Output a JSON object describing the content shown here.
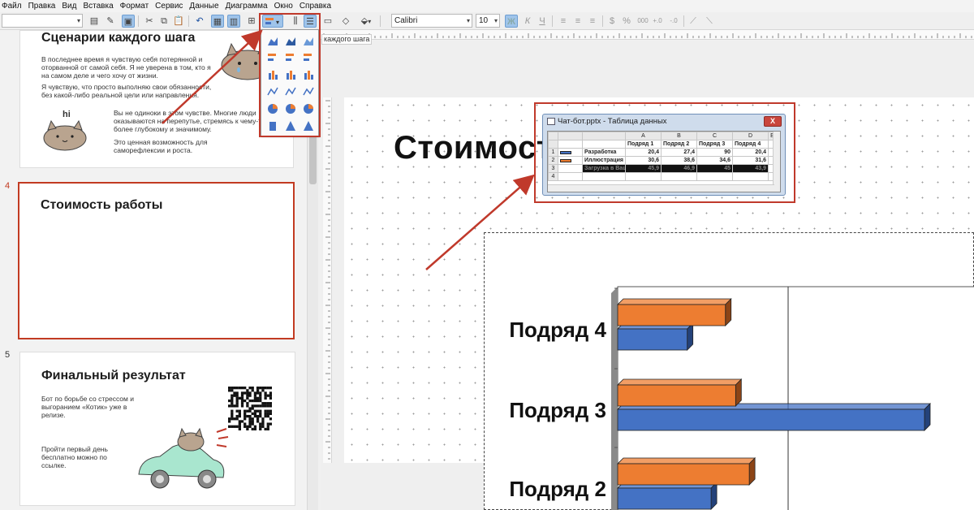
{
  "menubar": [
    "Файл",
    "Правка",
    "Вид",
    "Вставка",
    "Формат",
    "Сервис",
    "Данные",
    "Диаграмма",
    "Окно",
    "Справка"
  ],
  "toolbar": {
    "font_name": "Calibri",
    "font_size": "10",
    "bold_label": "Ж",
    "italic_label": "К",
    "underline_label": "Ч"
  },
  "tooltip": "каждого шага",
  "slides": {
    "s3": {
      "title": "Сценарии каждого шага",
      "p1": "В последнее время я чувствую себя потерянной и оторванной от самой себя. Я не уверена в том, кто я на самом деле и чего хочу от жизни.",
      "p2": "Я чувствую, что просто выполняю свои обязанности, без какой-либо реальной цели или направления.",
      "hi": "hi",
      "p3": "Вы не одиноки в этом чувстве. Многие люди оказываются на перепутье, стремясь к чему-то более глубокому и значимому.",
      "p4": "Это ценная возможность для саморефлексии и роста."
    },
    "s4": {
      "num": "4",
      "title": "Стоимость работы"
    },
    "s5": {
      "num": "5",
      "title": "Финальный результат",
      "p1": "Бот по борьбе со стрессом и выгоранием «Котик» уже в релизе.",
      "p2": "Пройти первый день бесплатно можно по ссылке."
    }
  },
  "main": {
    "title": "Стоимость работы"
  },
  "data_window": {
    "title": "Чат-бот.pptx - Таблица данных",
    "close": "X",
    "col_letters": [
      "A",
      "B",
      "C",
      "D",
      "E"
    ],
    "col_names": [
      "Подряд 1",
      "Подряд 2",
      "Подряд 3",
      "Подряд 4"
    ],
    "rows": [
      {
        "n": "1",
        "label": "Разработка",
        "values": [
          "20,4",
          "27,4",
          "90",
          "20,4"
        ]
      },
      {
        "n": "2",
        "label": "Иллюстрация",
        "values": [
          "30,6",
          "38,6",
          "34,6",
          "31,6"
        ]
      },
      {
        "n": "3",
        "label": "Загрузка в Ваш сайт",
        "values": [
          "45,9",
          "46,9",
          "45",
          "43,9"
        ]
      },
      {
        "n": "4",
        "label": "",
        "values": [
          "",
          "",
          "",
          ""
        ]
      }
    ]
  },
  "chart_data": {
    "type": "bar",
    "orientation": "horizontal",
    "categories": [
      "Подряд 2",
      "Подряд 3",
      "Подряд 4"
    ],
    "series": [
      {
        "name": "Разработка",
        "color": "#4472c4",
        "values": [
          27.4,
          90,
          20.4
        ]
      },
      {
        "name": "Иллюстрация",
        "color": "#ed7d31",
        "values": [
          38.6,
          34.6,
          31.6
        ]
      }
    ],
    "xlim": [
      0,
      100
    ]
  },
  "colors": {
    "accent_red": "#c0392b",
    "selected_slide_border": "#c23b22"
  }
}
